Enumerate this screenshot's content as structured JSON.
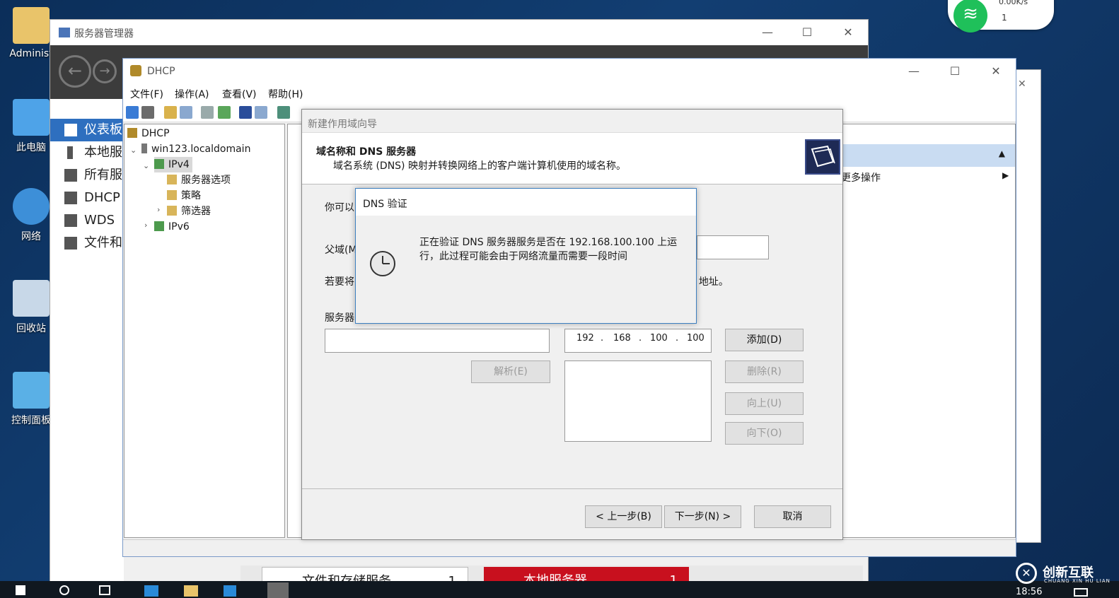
{
  "desktop": {
    "icons": [
      {
        "label": "Administ"
      },
      {
        "label": "此电脑"
      },
      {
        "label": "网络"
      },
      {
        "label": "回收站"
      },
      {
        "label": "控制面板"
      }
    ]
  },
  "network_widget": {
    "speed": "0.00K/s",
    "count": "1"
  },
  "server_manager": {
    "title": "服务器管理器",
    "sidebar": [
      {
        "label": "仪表板",
        "active": true
      },
      {
        "label": "本地服务器"
      },
      {
        "label": "所有服务器"
      },
      {
        "label": "DHCP"
      },
      {
        "label": "WDS"
      },
      {
        "label": "文件和存储服务"
      }
    ],
    "bottom_tiles": [
      {
        "label": "文件和存储服务",
        "count": "1"
      },
      {
        "label": "本地服务器",
        "count": "1"
      }
    ]
  },
  "dhcp": {
    "title": "DHCP",
    "menu": [
      "文件(F)",
      "操作(A)",
      "查看(V)",
      "帮助(H)"
    ],
    "tree": {
      "root": "DHCP",
      "server": "win123.localdomain",
      "ipv4": "IPv4",
      "ipv4_children": [
        "服务器选项",
        "策略",
        "筛选器"
      ],
      "ipv6": "IPv6"
    },
    "actions": {
      "more": "更多操作"
    }
  },
  "wizard": {
    "title": "新建作用域向导",
    "heading": "域名称和 DNS 服务器",
    "subheading": "域名系统 (DNS) 映射并转换网络上的客户端计算机使用的域名称。",
    "intro_fragment": "你可以",
    "parent_domain_label": "父域(M",
    "instruction_fragment": "若要将",
    "instruction_tail": "P 地址。",
    "server_label": "服务器",
    "ip": [
      "192",
      "168",
      "100",
      "100"
    ],
    "buttons": {
      "resolve": "解析(E)",
      "add": "添加(D)",
      "remove": "删除(R)",
      "up": "向上(U)",
      "down": "向下(O)",
      "back": "< 上一步(B)",
      "next": "下一步(N) >",
      "cancel": "取消"
    }
  },
  "dns_dialog": {
    "title": "DNS 验证",
    "message": "正在验证 DNS 服务器服务是否在 192.168.100.100 上运行，此过程可能会由于网络流量而需要一段时间"
  },
  "taskbar": {
    "time": "18:56"
  },
  "watermark": {
    "name": "创新互联",
    "sub": "CHUANG XIN HU LIAN"
  }
}
